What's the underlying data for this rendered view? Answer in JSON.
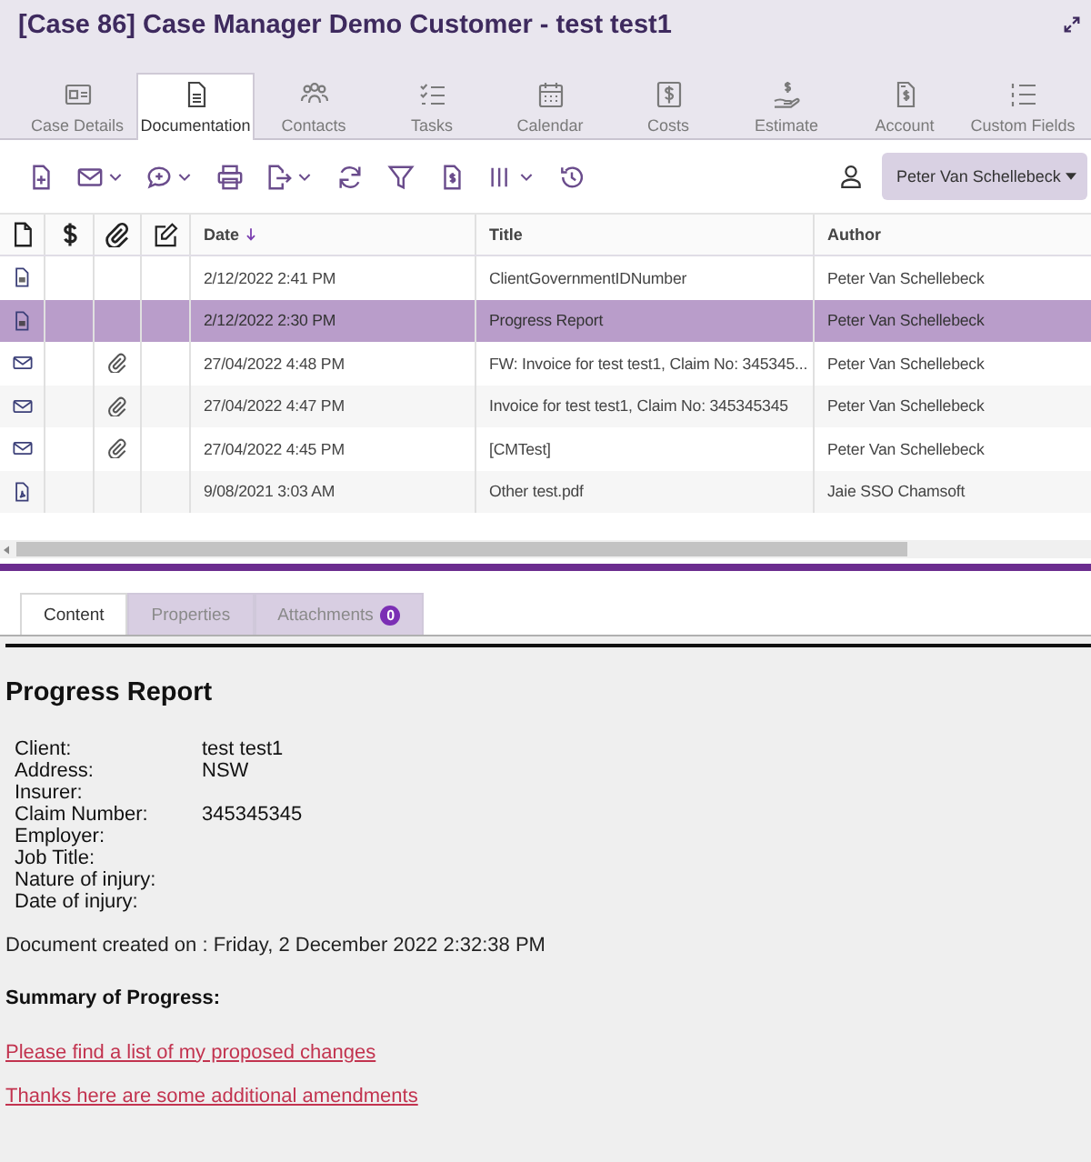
{
  "window": {
    "title": "[Case 86] Case Manager Demo Customer - test test1"
  },
  "tabs": [
    {
      "label": "Case Details",
      "selected": false
    },
    {
      "label": "Documentation",
      "selected": true
    },
    {
      "label": "Contacts",
      "selected": false
    },
    {
      "label": "Tasks",
      "selected": false
    },
    {
      "label": "Calendar",
      "selected": false
    },
    {
      "label": "Costs",
      "selected": false
    },
    {
      "label": "Estimate",
      "selected": false
    },
    {
      "label": "Account",
      "selected": false
    },
    {
      "label": "Custom Fields",
      "selected": false
    }
  ],
  "toolbar": [
    {
      "dropdown": false
    },
    {
      "dropdown": true
    },
    {
      "dropdown": true
    },
    {
      "dropdown": false
    },
    {
      "dropdown": true
    },
    {
      "dropdown": false
    },
    {
      "dropdown": false
    },
    {
      "dropdown": false
    },
    {
      "dropdown": true
    },
    {
      "dropdown": false
    }
  ],
  "user_filter": {
    "value": "Peter Van Schellebeck"
  },
  "table": {
    "columns": [
      {
        "label": "Date",
        "sorted": true
      },
      {
        "label": "Title",
        "sorted": false
      },
      {
        "label": "Author",
        "sorted": false
      }
    ],
    "rows": [
      {
        "kind": "document",
        "attachment": false,
        "date": "2/12/2022 2:41 PM",
        "title": "ClientGovernmentIDNumber",
        "author": "Peter Van Schellebeck",
        "selected": false
      },
      {
        "kind": "document",
        "attachment": false,
        "date": "2/12/2022 2:30 PM",
        "title": "Progress Report",
        "author": "Peter Van Schellebeck",
        "selected": true
      },
      {
        "kind": "email",
        "attachment": true,
        "date": "27/04/2022 4:48 PM",
        "title": "FW: Invoice for test test1, Claim No: 345345...",
        "author": "Peter Van Schellebeck",
        "selected": false
      },
      {
        "kind": "email",
        "attachment": true,
        "date": "27/04/2022 4:47 PM",
        "title": "Invoice for test test1, Claim No: 345345345",
        "author": "Peter Van Schellebeck",
        "selected": false
      },
      {
        "kind": "email",
        "attachment": true,
        "date": "27/04/2022 4:45 PM",
        "title": "[CMTest]",
        "author": "Peter Van Schellebeck",
        "selected": false
      },
      {
        "kind": "pdf",
        "attachment": false,
        "date": "9/08/2021 3:03 AM",
        "title": "Other test.pdf",
        "author": "Jaie SSO Chamsoft",
        "selected": false
      }
    ]
  },
  "detail_tabs": [
    {
      "label": "Content",
      "selected": true
    },
    {
      "label": "Properties",
      "selected": false
    },
    {
      "label": "Attachments",
      "badge": "0",
      "selected": false
    }
  ],
  "document": {
    "heading": "Progress Report",
    "fields": [
      {
        "label": "Client:",
        "value": "test test1"
      },
      {
        "label": "Address:",
        "value": "NSW"
      },
      {
        "label": "Insurer:"
      },
      {
        "label": "Claim Number:",
        "value": "345345345"
      },
      {
        "label": "Employer:"
      },
      {
        "label": "Job Title:"
      },
      {
        "label": "Nature of injury:"
      },
      {
        "label": "Date of injury:"
      }
    ],
    "created": "Document created on : Friday, 2 December 2022 2:32:38 PM",
    "summary_heading": "Summary of Progress:",
    "links": [
      "Please find a list of my proposed changes",
      "Thanks here are some additional amendments"
    ]
  }
}
